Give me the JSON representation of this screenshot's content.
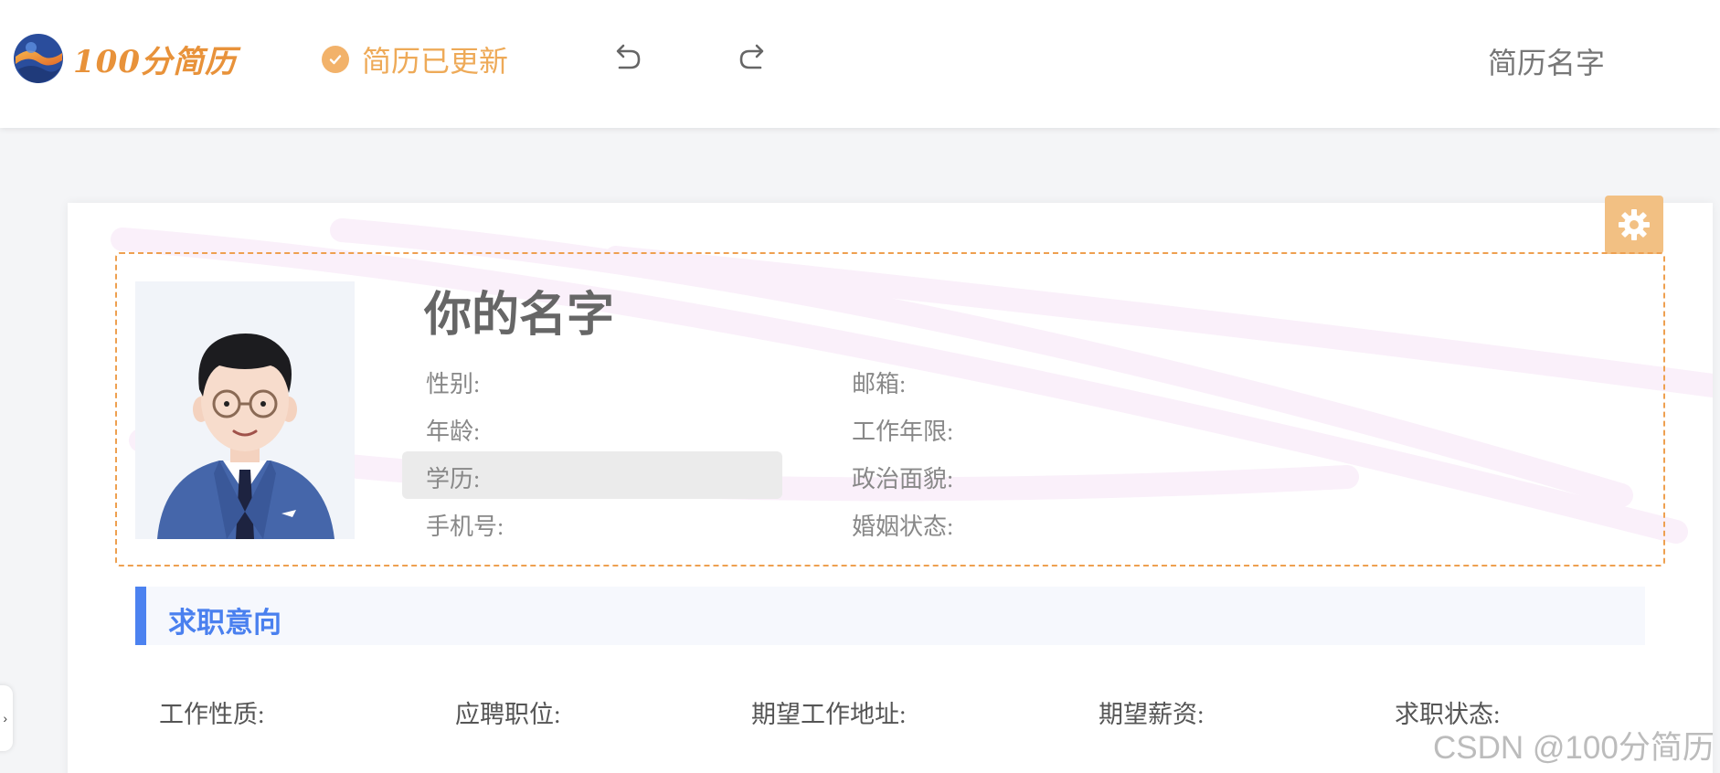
{
  "header": {
    "logo_text": "100分简历",
    "status_text": "简历已更新",
    "resume_name": "简历名字"
  },
  "profile": {
    "name": "你的名字",
    "fields": {
      "gender": "性别:",
      "age": "年龄:",
      "education": "学历:",
      "phone": "手机号:",
      "email": "邮箱:",
      "work_years": "工作年限:",
      "political_status": "政治面貌:",
      "marital_status": "婚姻状态:"
    }
  },
  "job_intent": {
    "title": "求职意向",
    "fields": {
      "job_type": "工作性质:",
      "position": "应聘职位:",
      "location": "期望工作地址:",
      "salary": "期望薪资:",
      "status": "求职状态:"
    }
  },
  "side_tab": {
    "label": "›"
  },
  "watermark": "CSDN @100分简历",
  "colors": {
    "brand_orange": "#e8923a",
    "accent_blue": "#4c82f0",
    "gear_bg": "#f2c083",
    "dashed_border": "#eea050"
  },
  "icons": {
    "status": "check-circle-icon",
    "undo": "undo-icon",
    "redo": "redo-icon",
    "settings": "gear-icon"
  }
}
